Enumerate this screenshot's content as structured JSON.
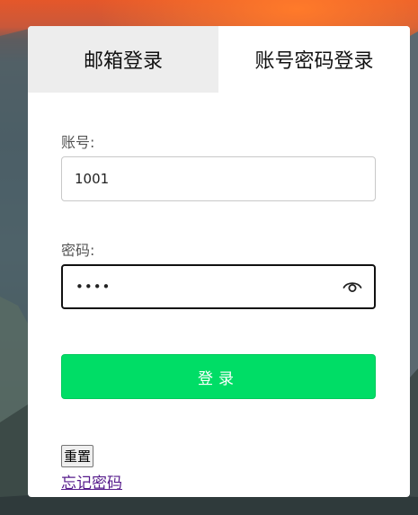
{
  "tabs": {
    "email_login": "邮箱登录",
    "password_login": "账号密码登录",
    "active": "password_login"
  },
  "form": {
    "account_label": "账号:",
    "account_value": "1001",
    "password_label": "密码:",
    "password_mask": "••••",
    "password_icon": "eye-icon"
  },
  "actions": {
    "login_label": "登录",
    "reset_label": "重置",
    "forgot_label": "忘记密码"
  },
  "colors": {
    "login_button": "#00dd66",
    "inactive_tab": "#ededed",
    "link": "#551a8b"
  }
}
